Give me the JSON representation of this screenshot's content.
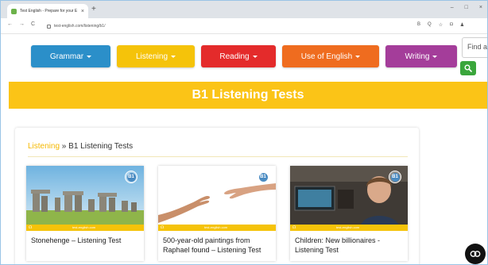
{
  "browser": {
    "tab_title": "Test English - Prepare for your E",
    "tab_close": "×",
    "new_tab": "+",
    "window_controls": [
      "–",
      "□",
      "×"
    ],
    "nav_buttons": [
      "←",
      "→",
      "C"
    ],
    "url": "test-english.com/listening/b1/",
    "extension_icons": [
      "B",
      "Q",
      "☆",
      "◘",
      "♟"
    ]
  },
  "nav": {
    "grammar": "Grammar",
    "listening": "Listening",
    "reading": "Reading",
    "use_of_english": "Use of English",
    "writing": "Writing",
    "search_placeholder": "Find a",
    "colors": {
      "grammar": "#2b8fc9",
      "listening": "#f5c30a",
      "reading": "#e42b2b",
      "use_of_english": "#ef6c1f",
      "writing": "#a43d9a",
      "search": "#3aa63b"
    }
  },
  "banner": {
    "title": "B1 Listening Tests",
    "color": "#fbc417"
  },
  "breadcrumb": {
    "link": "Listening",
    "separator": " » ",
    "current": "B1 Listening Tests"
  },
  "cards": [
    {
      "title": "Stonehenge – Listening Test",
      "badge": "B1",
      "strip_label": "test-english.com",
      "icon": "headphones-icon",
      "image": "stonehenge-photo"
    },
    {
      "title": "500-year-old paintings from Raphael found – Listening Test",
      "badge": "B1",
      "strip_label": "test-english.com",
      "icon": "headphones-icon",
      "image": "creation-of-adam-hands"
    },
    {
      "title": "Children: New billionaires - Listening Test",
      "badge": "B1",
      "strip_label": "test-english.com",
      "icon": "headphones-icon",
      "image": "boy-video-still"
    }
  ],
  "fab": {
    "icon": "chat-icon",
    "color": "#111111"
  }
}
